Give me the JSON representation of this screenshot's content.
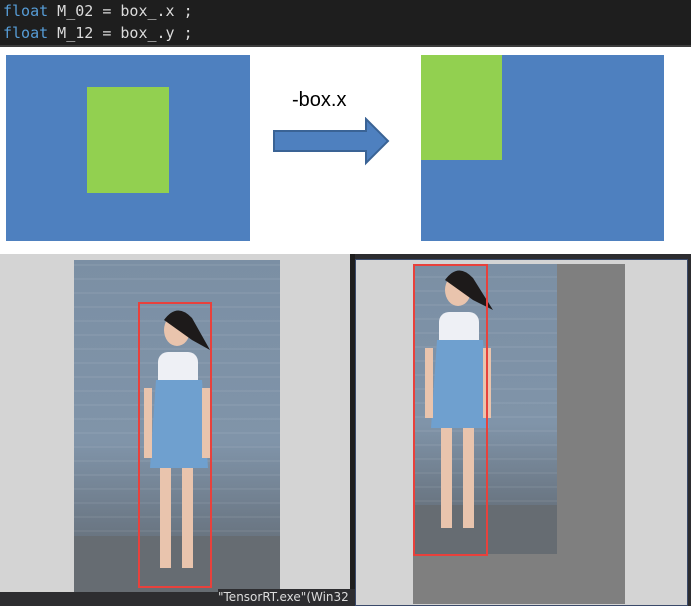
{
  "code": {
    "line1": {
      "keyword": "float",
      "rest": " M_02 = box_.x ;"
    },
    "line2": {
      "keyword": "float",
      "rest": " M_12 = box_.y ;"
    }
  },
  "diagram": {
    "arrow_label": "-box.x",
    "colors": {
      "blue": "#4e80bf",
      "green": "#92d050",
      "arrow": "#4e80bf"
    }
  },
  "panels": {
    "taskbar_text": "\"TensorRT.exe\"(Win32",
    "bbox_color": "#e8413c"
  }
}
